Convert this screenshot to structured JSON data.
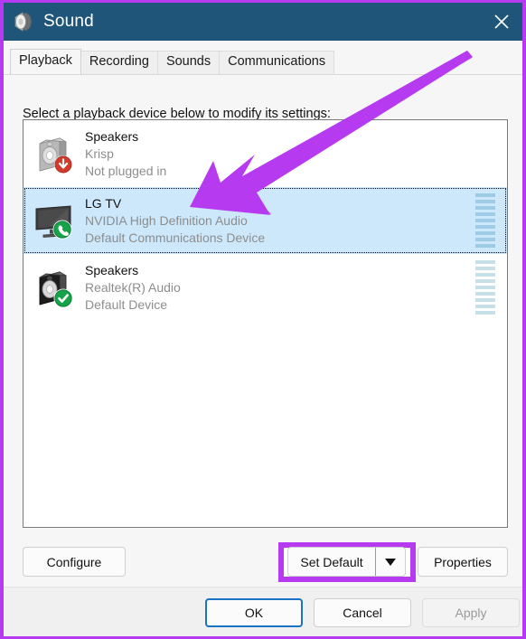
{
  "window": {
    "title": "Sound",
    "icon": "speaker-icon",
    "close_label": "✕",
    "titlebar_color": "#1f5578"
  },
  "tabs": [
    {
      "label": "Playback",
      "active": true
    },
    {
      "label": "Recording",
      "active": false
    },
    {
      "label": "Sounds",
      "active": false
    },
    {
      "label": "Communications",
      "active": false
    }
  ],
  "instruction": "Select a playback device below to modify its settings:",
  "devices": [
    {
      "name": "Speakers",
      "driver": "Krisp",
      "status": "Not plugged in",
      "icon": "speaker-box-gray-icon",
      "badge": "red-down-arrow-badge",
      "selected": false,
      "meter_segments": 0,
      "meter_style": "none"
    },
    {
      "name": "LG TV",
      "driver": "NVIDIA High Definition Audio",
      "status": "Default Communications Device",
      "icon": "tv-monitor-icon",
      "badge": "green-phone-badge",
      "selected": true,
      "meter_segments": 9,
      "meter_style": "dark"
    },
    {
      "name": "Speakers",
      "driver": "Realtek(R) Audio",
      "status": "Default Device",
      "icon": "speaker-box-black-icon",
      "badge": "green-check-badge",
      "selected": false,
      "meter_segments": 9,
      "meter_style": "light"
    }
  ],
  "actions": {
    "configure": "Configure",
    "set_default": "Set Default",
    "set_default_dropdown": "chevron-down-icon",
    "properties": "Properties"
  },
  "footer": {
    "ok": "OK",
    "cancel": "Cancel",
    "apply": "Apply",
    "apply_disabled": true
  },
  "annotations": {
    "arrow_color": "#b63bf0",
    "highlight_color": "#b63bf0",
    "highlight_target": "set-default-button",
    "arrow_points_to": "lg-tv-device-row"
  },
  "colors": {
    "selection_bg": "#cde8fb",
    "meter_dark": "#9fcbe6",
    "meter_light": "#c7e0e8",
    "accent": "#b63bf0"
  }
}
